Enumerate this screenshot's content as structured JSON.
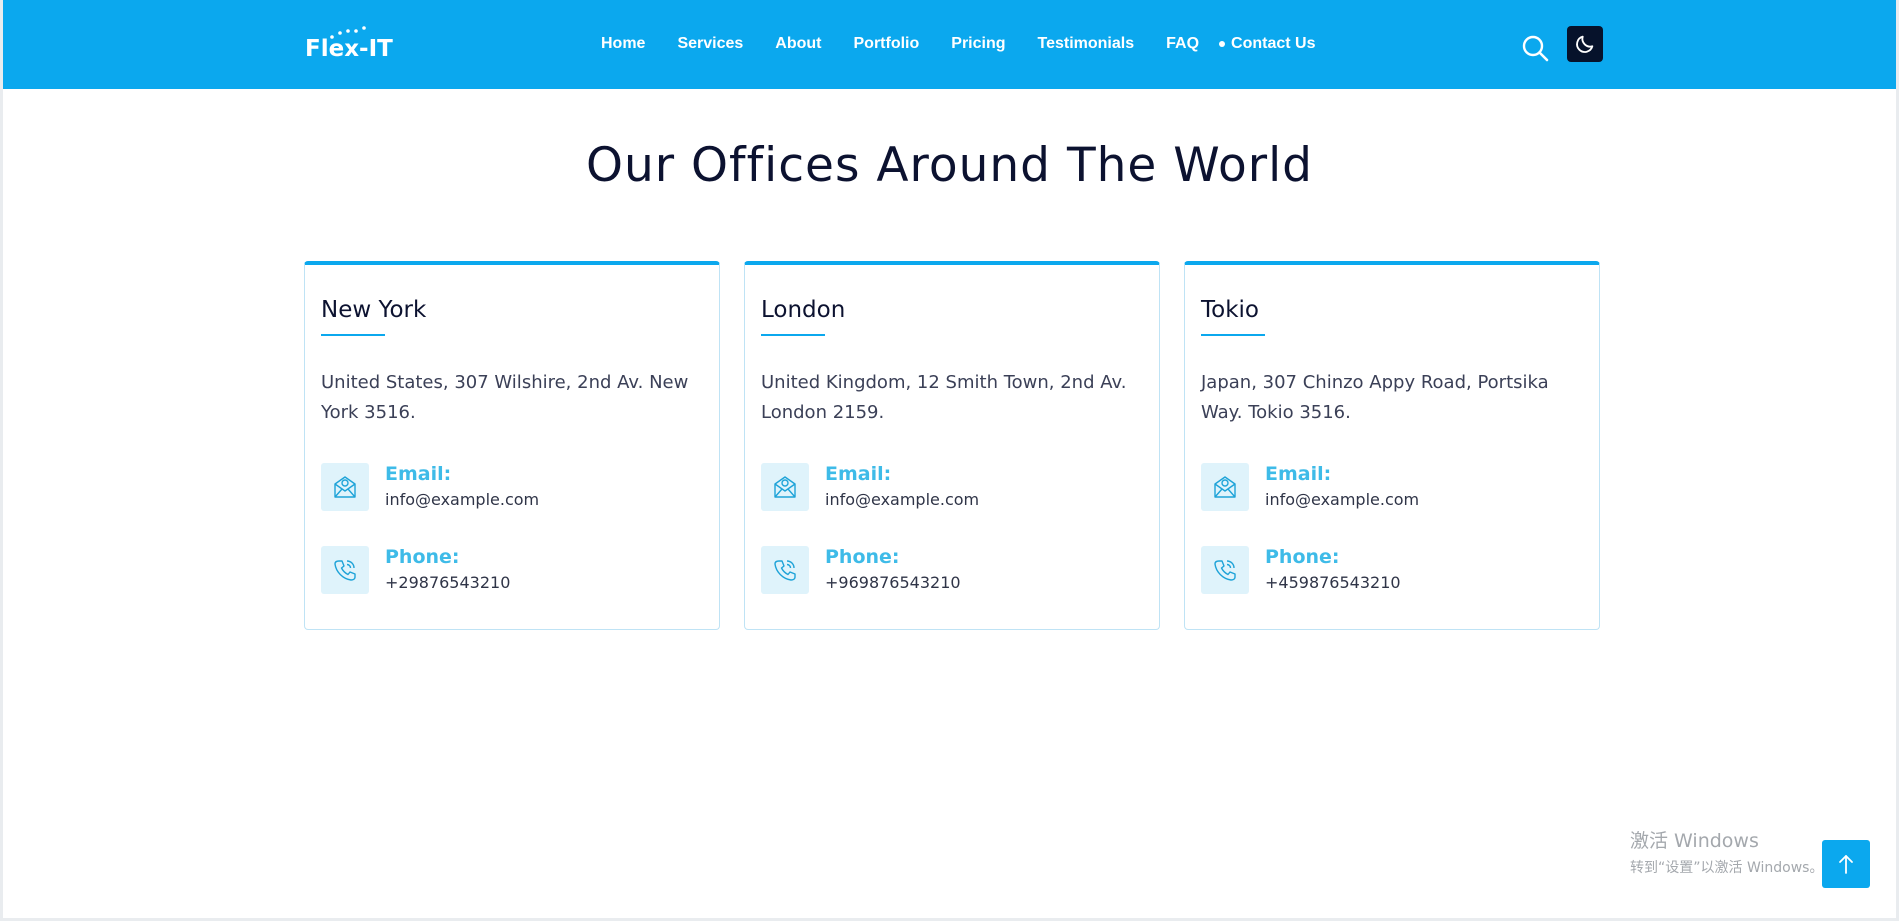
{
  "header": {
    "logo_text": "Flex-IT",
    "nav": [
      {
        "label": "Home"
      },
      {
        "label": "Services"
      },
      {
        "label": "About"
      },
      {
        "label": "Portfolio"
      },
      {
        "label": "Pricing"
      },
      {
        "label": "Testimonials"
      },
      {
        "label": "FAQ"
      },
      {
        "label": "Contact Us",
        "active": true
      }
    ],
    "search_icon": "search-icon",
    "theme_icon": "moon-icon"
  },
  "main": {
    "title": "Our Offices Around The World",
    "offices": [
      {
        "city": "New York",
        "address": "United States, 307 Wilshire, 2nd Av. New York 3516.",
        "email_label": "Email:",
        "email": "info@example.com",
        "phone_label": "Phone:",
        "phone": "+29876543210"
      },
      {
        "city": "London",
        "address": "United Kingdom, 12 Smith Town, 2nd Av. London 2159.",
        "email_label": "Email:",
        "email": "info@example.com",
        "phone_label": "Phone:",
        "phone": "+969876543210"
      },
      {
        "city": "Tokio",
        "address": "Japan, 307 Chinzo Appy Road, Portsika Way. Tokio 3516.",
        "email_label": "Email:",
        "email": "info@example.com",
        "phone_label": "Phone:",
        "phone": "+459876543210"
      }
    ]
  },
  "watermark": {
    "title": "激活 Windows",
    "subtitle": "转到“设置”以激活 Windows。"
  },
  "back_to_top_icon": "arrow-up-icon",
  "colors": {
    "primary": "#0ba8ee",
    "dark": "#06122b",
    "accent_text": "#3ebbe8"
  }
}
